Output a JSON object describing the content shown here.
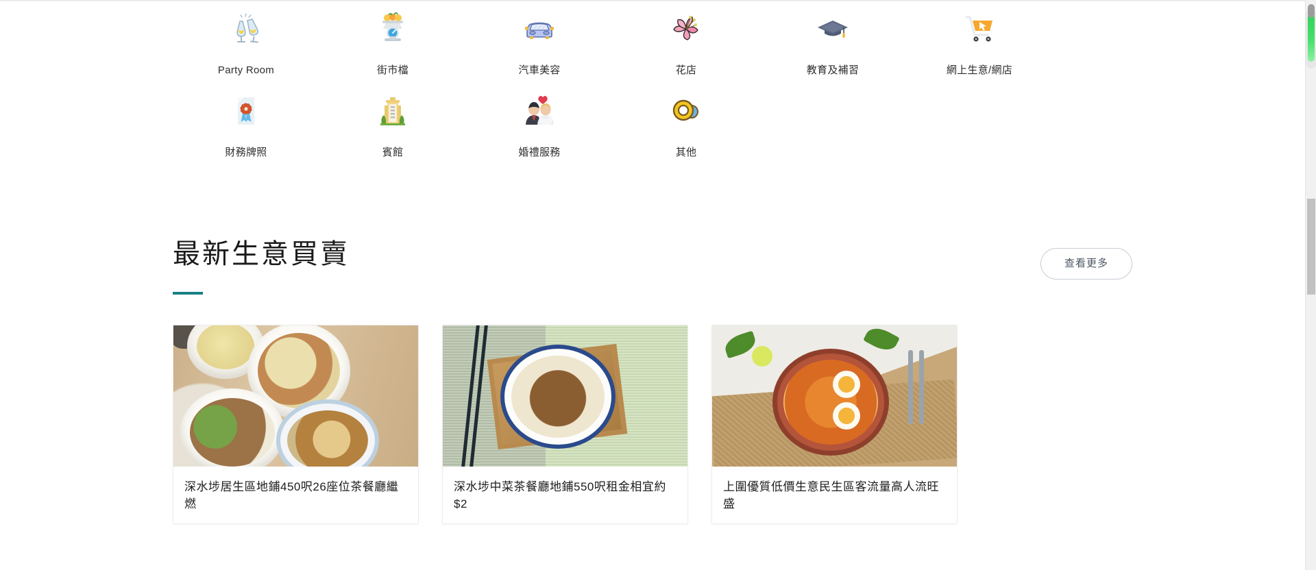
{
  "categories": [
    {
      "label": "Party Room",
      "icon": "champagne-glasses-icon"
    },
    {
      "label": "街市檔",
      "icon": "market-scale-icon"
    },
    {
      "label": "汽車美容",
      "icon": "car-icon"
    },
    {
      "label": "花店",
      "icon": "flower-icon"
    },
    {
      "label": "教育及補習",
      "icon": "graduation-cap-icon"
    },
    {
      "label": "網上生意/網店",
      "icon": "shopping-cart-icon"
    },
    {
      "label": "財務牌照",
      "icon": "license-certificate-icon"
    },
    {
      "label": "賓館",
      "icon": "hotel-building-icon"
    },
    {
      "label": "婚禮服務",
      "icon": "wedding-couple-icon"
    },
    {
      "label": "其他",
      "icon": "rings-other-icon"
    }
  ],
  "section": {
    "title": "最新生意買賣",
    "more_label": "查看更多",
    "accent_color": "#1a7f86"
  },
  "cards": [
    {
      "title": "深水埗居生區地鋪450呎26座位茶餐廳繼燃",
      "image_alt": "beef-noodle-and-rice-set-photo"
    },
    {
      "title": "深水埗中菜茶餐廳地鋪550呎租金相宜約$2",
      "image_alt": "noodle-bowl-on-bamboo-tray-photo"
    },
    {
      "title": "上圍優質低價生意民生區客流量高人流旺盛",
      "image_alt": "spicy-seafood-noodle-bowl-photo"
    }
  ],
  "scrollbar": {
    "name": "page-scrollbar",
    "thumb_color": "#c1c1c1",
    "indicator_color": "#31d158"
  }
}
